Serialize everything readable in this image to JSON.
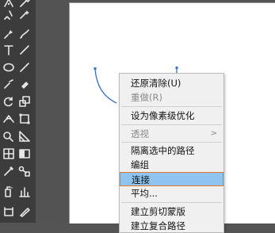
{
  "toolbar": {
    "tools": [
      "pen-tool-icon",
      "eyedropper-tool-icon",
      "pen-tool-icon",
      "curvature-tool-icon",
      "type-tool-icon",
      "line-segment-tool-icon",
      "ellipse-tool-icon",
      "paintbrush-tool-icon",
      "pencil-tool-icon",
      "eraser-tool-icon",
      "rotate-tool-icon",
      "scale-tool-icon",
      "width-tool-icon",
      "free-transform-tool-icon",
      "shape-builder-tool-icon",
      "perspective-grid-tool-icon",
      "mesh-tool-icon",
      "gradient-tool-icon",
      "eyedropper-tool-icon",
      "blend-tool-icon",
      "symbol-sprayer-tool-icon",
      "column-graph-tool-icon",
      "artboard-tool-icon",
      "slice-tool-icon"
    ]
  },
  "menu": {
    "items": [
      {
        "label": "还原清除(U)",
        "enabled": true
      },
      {
        "label": "重做(R)",
        "enabled": false
      },
      {
        "separator": true
      },
      {
        "label": "设为像素级优化",
        "enabled": true
      },
      {
        "separator": true
      },
      {
        "label": "透视",
        "enabled": false,
        "submenu": true
      },
      {
        "separator": true
      },
      {
        "label": "隔离选中的路径",
        "enabled": true
      },
      {
        "label": "编组",
        "enabled": true
      },
      {
        "label": "连接",
        "enabled": true,
        "selected": true
      },
      {
        "label": "平均...",
        "enabled": true
      },
      {
        "separator": true
      },
      {
        "label": "建立剪切蒙版",
        "enabled": true
      },
      {
        "label": "建立复合路径",
        "enabled": true
      }
    ],
    "submenu_arrow": ">"
  },
  "colors": {
    "selected_bg": "#8ec4ef",
    "selected_border": "#e07a28",
    "path_stroke": "#2f6fd6"
  }
}
